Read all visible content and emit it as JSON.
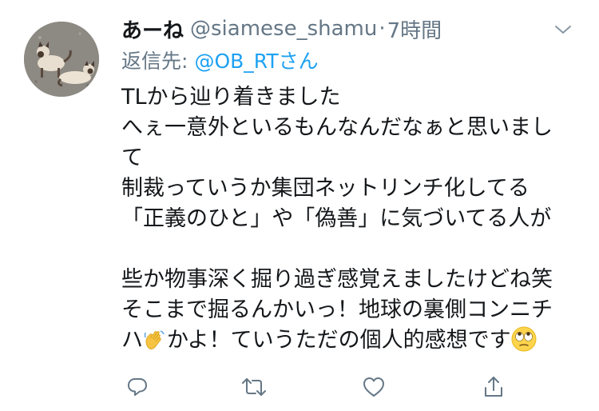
{
  "tweet": {
    "display_name": "あーね",
    "handle": "@siamese_shamu",
    "separator": "·",
    "time": "7時間",
    "reply_prefix": "返信先:",
    "reply_target": "@OB_RTさん",
    "lines": [
      "TLから辿り着きました",
      "へぇ一意外といるもんなんだなぁと思いまし",
      "て",
      "制裁っていうか集団ネットリンチ化してる",
      "「正義のひと」や「偽善」に気づいてる人が",
      "",
      "些か物事深く掘り過ぎ感覚えましたけどね笑",
      "そこまで掘るんかいっ！地球の裏側コンニチ"
    ],
    "last_line_a": "ハ",
    "last_line_b": "かよ！ていうただの個人的感想です",
    "emoji_1": "waving-hand-emoji",
    "emoji_2": "eye-roll-emoji"
  },
  "avatar": {
    "subject": "two siamese cats on gravel"
  },
  "icons": {
    "menu": "chevron-down-icon",
    "reply": "reply-icon",
    "retweet": "retweet-icon",
    "like": "heart-icon",
    "share": "share-icon"
  },
  "colors": {
    "text": "#14171a",
    "secondary": "#657786",
    "link": "#1da1f2",
    "icon": "#657786"
  }
}
